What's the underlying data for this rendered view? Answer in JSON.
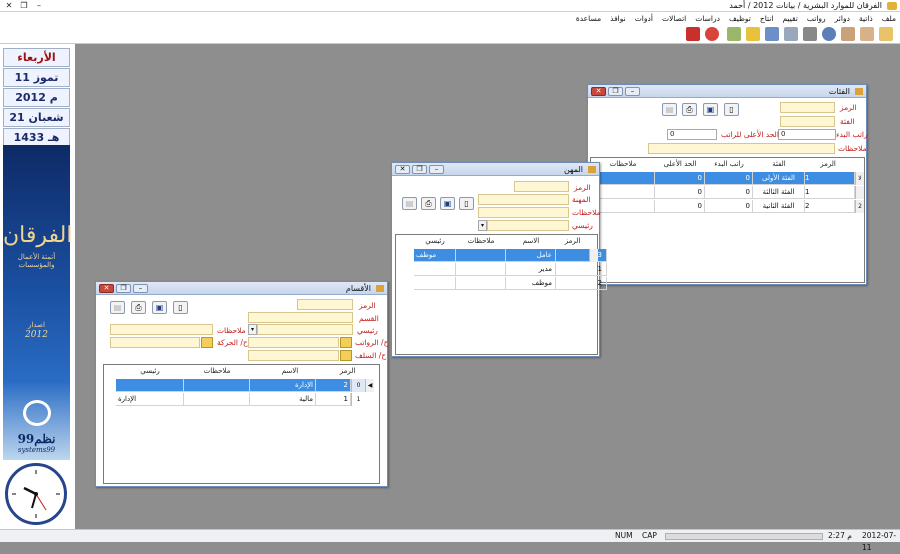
{
  "app": {
    "title": "الفرقان للموارد البشرية / بيانات 2012 / أحمد"
  },
  "menu": [
    "ملف",
    "ذاتية",
    "دوائر",
    "رواتب",
    "تقييم",
    "انتاج",
    "توظيف",
    "دراسات",
    "اتصالات",
    "أدوات",
    "نوافذ",
    "مساعدة"
  ],
  "toolbar_icons": [
    "user-icon",
    "users-icon",
    "person-icon",
    "id-card-icon",
    "clock-icon",
    "pen-icon",
    "book-icon",
    "calculator-icon",
    "lock-icon",
    "add-page-icon",
    "zoom-icon",
    "power-icon"
  ],
  "sidebar": {
    "day": "الأربعاء",
    "greg_date": "11 تموز",
    "greg_year": "2012 م",
    "hijri_date": "21 شعبان",
    "hijri_year": "1433 هـ",
    "brand": "الفرقان",
    "brand_sub": "أتمتة الأعمال والمؤسسات",
    "edition_label": "اصدار",
    "edition_year": "2012",
    "company": "نظم99",
    "company_latin": "systems99"
  },
  "win_ranks": {
    "title": "الفئات",
    "labels": {
      "code": "الرمز",
      "category": "الفئة",
      "start_salary": "راتب البدء",
      "max_salary": "الحد الأعلى للراتب",
      "notes": "ملاحظات"
    },
    "start_salary_value": "0",
    "max_salary_value": "0",
    "columns": [
      "الرمز",
      "الفئة",
      "راتب البدء",
      "الحد الأعلى",
      "ملاحظات"
    ],
    "rows": [
      {
        "code": "1",
        "name": "الفئة الأولى",
        "start": "0",
        "max": "0",
        "notes": "",
        "selected": true
      },
      {
        "code": "1",
        "name": "الفئة الثالثة",
        "start": "0",
        "max": "0",
        "notes": "",
        "selected": false
      },
      {
        "code": "2",
        "name": "الفئة الثانية",
        "start": "0",
        "max": "0",
        "notes": "",
        "selected": false
      }
    ],
    "indicators": [
      "ﻻ",
      "",
      "2"
    ]
  },
  "win_jobs": {
    "title": "المهن",
    "labels": {
      "code": "الرمز",
      "job": "المهنة",
      "notes": "ملاحظات",
      "main": "رئيسي"
    },
    "columns": [
      "الرمز",
      "الاسم",
      "ملاحظات",
      "رئيسي"
    ],
    "rows": [
      {
        "code": "3",
        "name": "عامل",
        "notes": "",
        "main": "موظف",
        "selected": true
      },
      {
        "code": "1",
        "name": "مدير",
        "notes": "",
        "main": "",
        "selected": false
      },
      {
        "code": "2",
        "name": "موظف",
        "notes": "",
        "main": "",
        "selected": false
      }
    ]
  },
  "win_depts": {
    "title": "الأقسام",
    "labels": {
      "code": "الرمز",
      "dept": "القسم",
      "main": "رئيسي",
      "salary_acct": "ح/ الرواتب",
      "advance_acct": "ح/ السلف",
      "notes": "ملاحظات",
      "movement_acct": "ح/ الحركة"
    },
    "columns": [
      "الرمز",
      "الاسم",
      "ملاحظات",
      "رئيسي"
    ],
    "rows": [
      {
        "ind": "0",
        "code": "2",
        "name": "الإدارة",
        "notes": "",
        "main": "",
        "selected": true
      },
      {
        "ind": "1",
        "code": "1",
        "name": "مالية",
        "notes": "",
        "main": "الإدارة",
        "selected": false
      }
    ]
  },
  "status": {
    "num": "NUM",
    "cap": "CAP",
    "time": "2:27 م",
    "date": "2012-07-11"
  },
  "colors": {
    "selected_row": "#3d8ee3",
    "field_bg": "#fff6d4",
    "label_red": "#c21818",
    "banner_blue": "#1a4fa0"
  }
}
